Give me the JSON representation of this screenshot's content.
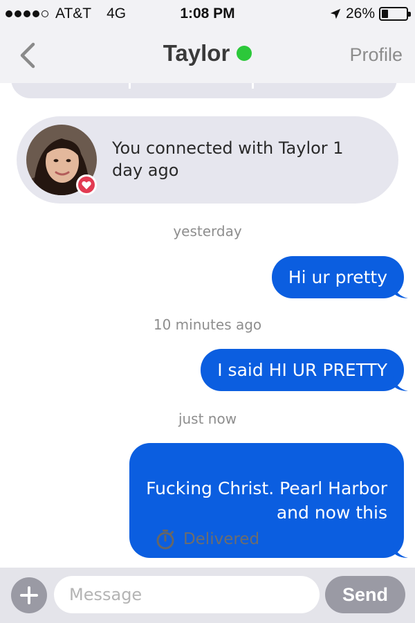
{
  "status_bar": {
    "signal_bars": 4,
    "carrier": "AT&T",
    "network": "4G",
    "time": "1:08 PM",
    "battery_percent": "26%",
    "battery_level": 0.26
  },
  "nav": {
    "back_icon": "chevron-left-icon",
    "title": "Taylor",
    "online": true,
    "online_color": "#2cc83a",
    "profile_label": "Profile"
  },
  "connection": {
    "text": "You connected with Taylor 1 day ago",
    "badge_icon": "heart-icon"
  },
  "messages": [
    {
      "timestamp": "yesterday",
      "text": "Hi ur pretty"
    },
    {
      "timestamp": "10 minutes ago",
      "text": "I said HI UR PRETTY"
    },
    {
      "timestamp": "just now",
      "text": "Fucking Christ. Pearl Harbor\nand now this"
    }
  ],
  "delivery": {
    "icon": "stopwatch-icon",
    "status": "Delivered"
  },
  "input_bar": {
    "add_icon": "plus-icon",
    "placeholder": "Message",
    "value": "",
    "send_label": "Send"
  },
  "colors": {
    "bubble": "#0b5ee0",
    "connect_card": "#e6e6ee",
    "heart": "#e23b52",
    "bar_background": "#f2f2f5"
  }
}
